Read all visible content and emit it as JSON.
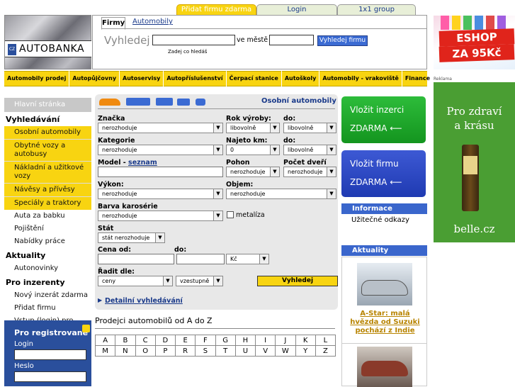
{
  "top_tabs": [
    "Přidat firmu zdarma",
    "Login",
    "1x1 group"
  ],
  "logo": {
    "cz": "CZ",
    "name": "AUTOBANKA"
  },
  "search": {
    "tab_active": "Firmy",
    "tab_inactive": "Automobily",
    "title": "Vyhledej",
    "city_label": "ve městě",
    "button": "Vyhledej firmu",
    "hint": "Zadej co hledáš"
  },
  "eshop": {
    "line1": "ESHOP",
    "line2": "ZA 95Kč"
  },
  "menu": [
    "Automobily prodej",
    "Autopůjčovny",
    "Autoservisy",
    "Autopříslušenství",
    "Čerpací stanice",
    "Autoškoly",
    "Automobily - vrakoviště",
    "Finance"
  ],
  "sidebar": {
    "home": "Hlavní stránka",
    "search_header": "Vyhledávání",
    "search_items": [
      "Osobní automobily",
      "Obytné vozy a autobusy",
      "Nákladní a užitkové vozy",
      "Návěsy a přívěsy",
      "Speciály a traktory",
      "Auta za babku",
      "Pojištění",
      "Nabídky práce"
    ],
    "news_header": "Aktuality",
    "news_items": [
      "Autonovinky"
    ],
    "adv_header": "Pro inzerenty",
    "adv_items": [
      "Nový inzerát zdarma",
      "Přidat firmu",
      "Vstup (login) pro registrované"
    ],
    "reg_header": "Pro registrované",
    "login_label": "Login",
    "password_label": "Heslo"
  },
  "form": {
    "title": "Osobní automobily",
    "brand_label": "Značka",
    "brand_value": "nerozhoduje",
    "year_label": "Rok výroby:",
    "year_from": "libovolně",
    "to_label": "do:",
    "year_to": "libovolně",
    "category_label": "Kategorie",
    "category_value": "nerozhoduje",
    "km_label": "Najeto km:",
    "km_from": "0",
    "km_to": "libovolně",
    "model_label": "Model",
    "model_link": "seznam",
    "drive_label": "Pohon",
    "drive_value": "nerozhoduje",
    "doors_label": "Počet dveří",
    "doors_value": "nerozhoduje",
    "power_label": "Výkon:",
    "power_value": "nerozhoduje",
    "volume_label": "Objem:",
    "volume_value": "nerozhoduje",
    "color_label": "Barva karosérie",
    "color_value": "nerozhoduje",
    "metallic_label": "metalíza",
    "state_label": "Stát",
    "state_value": "stát nerozhoduje",
    "price_from_label": "Cena od:",
    "price_to_label": "do:",
    "currency": "Kč",
    "sort_label": "Řadit dle:",
    "sort_value": "ceny",
    "sort_order": "vzestupně",
    "search_button": "Vyhledej",
    "detail_link": "Detailní vyhledávání"
  },
  "alphabet_title": "Prodejci automobilů od A do Z",
  "alphabet_rows": [
    [
      "A",
      "B",
      "C",
      "D",
      "E",
      "F",
      "G",
      "H",
      "I",
      "J",
      "K",
      "L"
    ],
    [
      "M",
      "N",
      "O",
      "P",
      "R",
      "S",
      "T",
      "U",
      "V",
      "W",
      "Y",
      "Z"
    ]
  ],
  "right": {
    "insert_ad": "Vložit inzerci",
    "free1": "ZDARMA",
    "insert_company": "Vložit firmu",
    "free2": "ZDARMA",
    "info_header": "Informace",
    "info_link": "Užitečné odkazy",
    "news_header": "Aktuality",
    "news_title": "A-Star: malá hvězda od Suzuki pochází z Indie"
  },
  "ad": {
    "label": "Reklama",
    "line1": "Pro zdraví",
    "line2": "a krásu",
    "site": "belle.cz"
  },
  "colors": {
    "yellow": "#f8d411",
    "blue": "#2a4f9c",
    "green": "#1fa82b",
    "ad_green": "#4a9e33"
  }
}
